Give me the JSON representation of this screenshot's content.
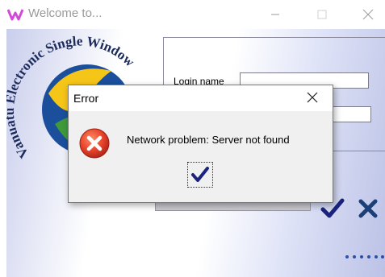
{
  "window": {
    "title": "Welcome to...",
    "icon": "app-logo-icon",
    "controls": [
      "minimize-icon",
      "maximize-icon",
      "close-icon"
    ]
  },
  "logo": {
    "text": "Vanuatu Electronic Single Window",
    "icon": "globe-logo-icon"
  },
  "login": {
    "login_name_label": "Login name",
    "login_name_value": "",
    "password_value": ""
  },
  "buttons": {
    "ok_icon": "checkmark-icon",
    "cancel_icon": "x-icon"
  },
  "dialog": {
    "title": "Error",
    "message": "Network problem: Server not found",
    "icon": "error-icon",
    "ok_icon": "checkmark-icon"
  },
  "colors": {
    "error_red": "#e8452c",
    "check_navy": "#1a237e",
    "logo_blue": "#1b4f9c",
    "logo_yellow": "#f5c518",
    "logo_green": "#3f9a3a"
  }
}
